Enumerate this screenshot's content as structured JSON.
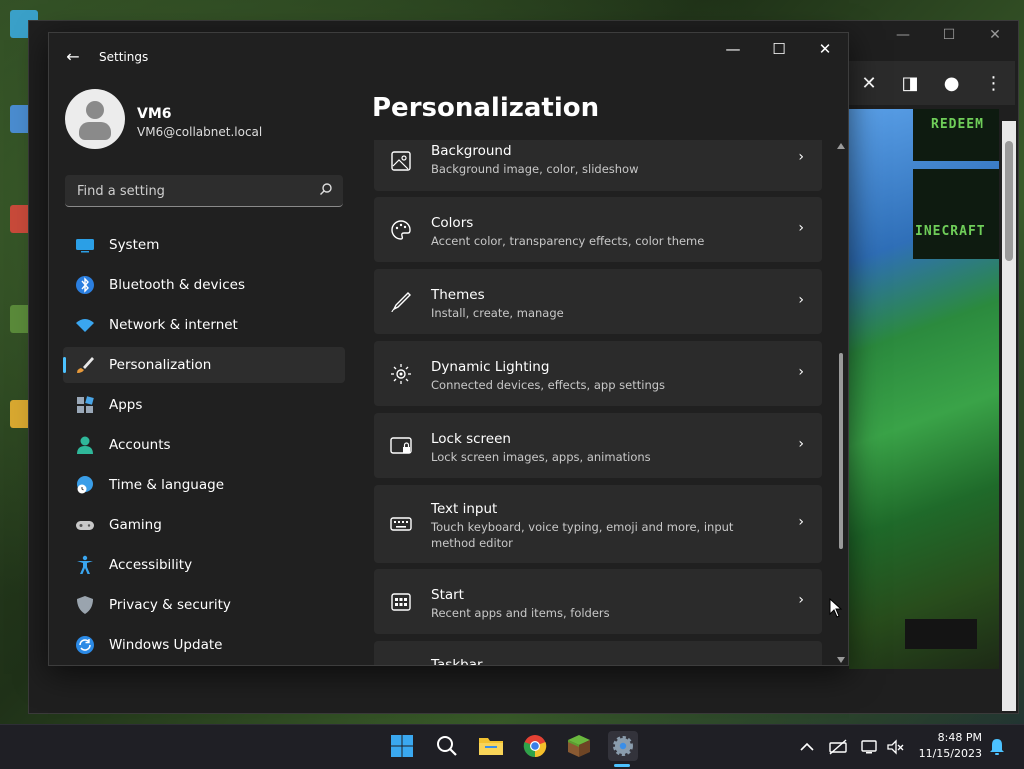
{
  "settings": {
    "app_title": "Settings",
    "user": {
      "name": "VM6",
      "email": "VM6@collabnet.local"
    },
    "search": {
      "placeholder": "Find a setting"
    },
    "nav": [
      {
        "label": "System",
        "icon": "system-icon",
        "selected": false
      },
      {
        "label": "Bluetooth & devices",
        "icon": "bluetooth-icon",
        "selected": false
      },
      {
        "label": "Network & internet",
        "icon": "wifi-icon",
        "selected": false
      },
      {
        "label": "Personalization",
        "icon": "brush-icon",
        "selected": true
      },
      {
        "label": "Apps",
        "icon": "apps-icon",
        "selected": false
      },
      {
        "label": "Accounts",
        "icon": "person-icon",
        "selected": false
      },
      {
        "label": "Time & language",
        "icon": "globe-clock-icon",
        "selected": false
      },
      {
        "label": "Gaming",
        "icon": "gamepad-icon",
        "selected": false
      },
      {
        "label": "Accessibility",
        "icon": "accessibility-icon",
        "selected": false
      },
      {
        "label": "Privacy & security",
        "icon": "shield-icon",
        "selected": false
      },
      {
        "label": "Windows Update",
        "icon": "update-icon",
        "selected": false
      }
    ],
    "page_title": "Personalization",
    "cards": [
      {
        "title": "Background",
        "subtitle": "Background image, color, slideshow",
        "icon": "image-icon"
      },
      {
        "title": "Colors",
        "subtitle": "Accent color, transparency effects, color theme",
        "icon": "palette-icon"
      },
      {
        "title": "Themes",
        "subtitle": "Install, create, manage",
        "icon": "pen-icon"
      },
      {
        "title": "Dynamic Lighting",
        "subtitle": "Connected devices, effects, app settings",
        "icon": "lighting-icon"
      },
      {
        "title": "Lock screen",
        "subtitle": "Lock screen images, apps, animations",
        "icon": "lock-screen-icon"
      },
      {
        "title": "Text input",
        "subtitle": "Touch keyboard, voice typing, emoji and more, input method editor",
        "icon": "keyboard-icon"
      },
      {
        "title": "Start",
        "subtitle": "Recent apps and items, folders",
        "icon": "start-menu-icon"
      },
      {
        "title": "Taskbar",
        "subtitle": "",
        "icon": "taskbar-icon"
      }
    ]
  },
  "browser": {
    "panel_text": {
      "redeem": "REDEEM",
      "minecraft": "INECRAFT"
    }
  },
  "taskbar": {
    "apps": [
      "windows-start",
      "search",
      "file-explorer",
      "chrome",
      "minecraft",
      "settings"
    ],
    "clock": {
      "time": "8:48 PM",
      "date": "11/15/2023"
    }
  },
  "colors": {
    "accent": "#4cc2ff",
    "window_bg": "#202020",
    "card_bg": "#2b2b2b",
    "minecraft_green": "#6fce59"
  }
}
